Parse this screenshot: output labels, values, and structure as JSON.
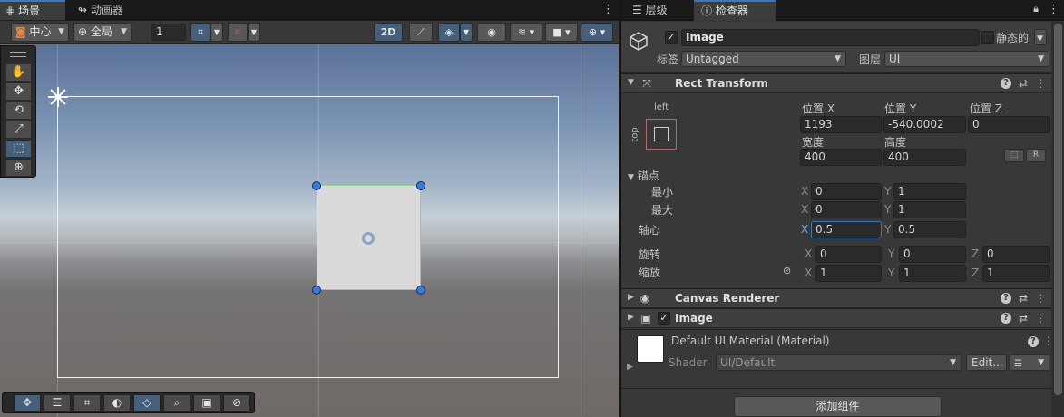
{
  "scene_tabs": {
    "scene": "场景",
    "animator": "动画器"
  },
  "scene_toolbar": {
    "pivot_mode": "中心",
    "space_mode": "全局",
    "grid_size": "1",
    "mode_2d": "2D"
  },
  "right_tabs": {
    "hierarchy": "层级",
    "inspector": "检查器"
  },
  "object": {
    "active": true,
    "name": "Image",
    "static_label": "静态的",
    "tag_label": "标签",
    "tag_value": "Untagged",
    "layer_label": "图层",
    "layer_value": "UI"
  },
  "rect_transform": {
    "title": "Rect Transform",
    "anchor_preset_horizontal": "left",
    "anchor_preset_vertical": "top",
    "pos_x_label": "位置 X",
    "pos_y_label": "位置 Y",
    "pos_z_label": "位置 Z",
    "pos_x": "1193",
    "pos_y": "-540.0002",
    "pos_z": "0",
    "width_label": "宽度",
    "height_label": "高度",
    "width": "400",
    "height": "400",
    "raw_button": "R",
    "anchors_label": "锚点",
    "min_label": "最小",
    "max_label": "最大",
    "min_x": "0",
    "min_y": "1",
    "max_x": "0",
    "max_y": "1",
    "pivot_label": "轴心",
    "pivot_x": "0.5",
    "pivot_y": "0.5",
    "rotation_label": "旋转",
    "rot_x": "0",
    "rot_y": "0",
    "rot_z": "0",
    "scale_label": "缩放",
    "scale_x": "1",
    "scale_y": "1",
    "scale_z": "1",
    "axis_x": "X",
    "axis_y": "Y",
    "axis_z": "Z"
  },
  "canvas_renderer": {
    "title": "Canvas Renderer"
  },
  "image_component": {
    "title": "Image",
    "enabled": true
  },
  "material": {
    "name": "Default UI Material (Material)",
    "shader_label": "Shader",
    "shader_value": "UI/Default",
    "edit_button": "Edit..."
  },
  "add_component_button": "添加组件",
  "colors": {
    "accent": "#3a79bb",
    "selection_handle": "#3a7ae0",
    "panel_bg": "#383838"
  }
}
